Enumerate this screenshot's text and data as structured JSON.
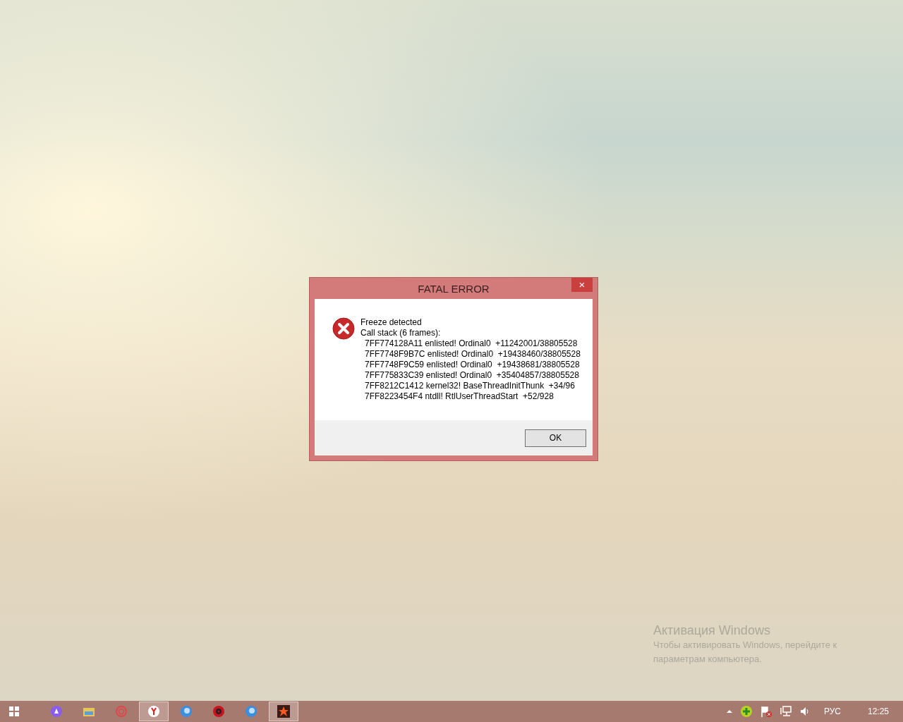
{
  "dialog": {
    "title": "FATAL ERROR",
    "close": "×",
    "message": [
      "Freeze detected",
      "Call stack (6 frames):"
    ],
    "frames": [
      "7FF774128A11 enlisted! Ordinal0  +11242001/38805528",
      "7FF7748F9B7C enlisted! Ordinal0  +19438460/38805528",
      "7FF7748F9C59 enlisted! Ordinal0  +19438681/38805528",
      "7FF775833C39 enlisted! Ordinal0  +35404857/38805528",
      "7FF8212C1412 kernel32! BaseThreadInitThunk  +34/96",
      "7FF8223454F4 ntdll! RtlUserThreadStart  +52/928"
    ],
    "button": "OK"
  },
  "activation": {
    "title": "Активация Windows",
    "lines": [
      "Чтобы активировать Windows, перейдите к",
      "параметрам компьютера."
    ]
  },
  "taskbar": {
    "apps": [
      {
        "kind": "assistant",
        "selected": false
      },
      {
        "kind": "folder",
        "selected": false
      },
      {
        "kind": "ring",
        "selected": false
      },
      {
        "kind": "browser",
        "selected": true
      },
      {
        "kind": "globe",
        "selected": false
      },
      {
        "kind": "gear",
        "selected": false
      },
      {
        "kind": "globe",
        "selected": false
      },
      {
        "kind": "game",
        "selected": true
      }
    ],
    "language": "РУС",
    "time": "12:25"
  }
}
